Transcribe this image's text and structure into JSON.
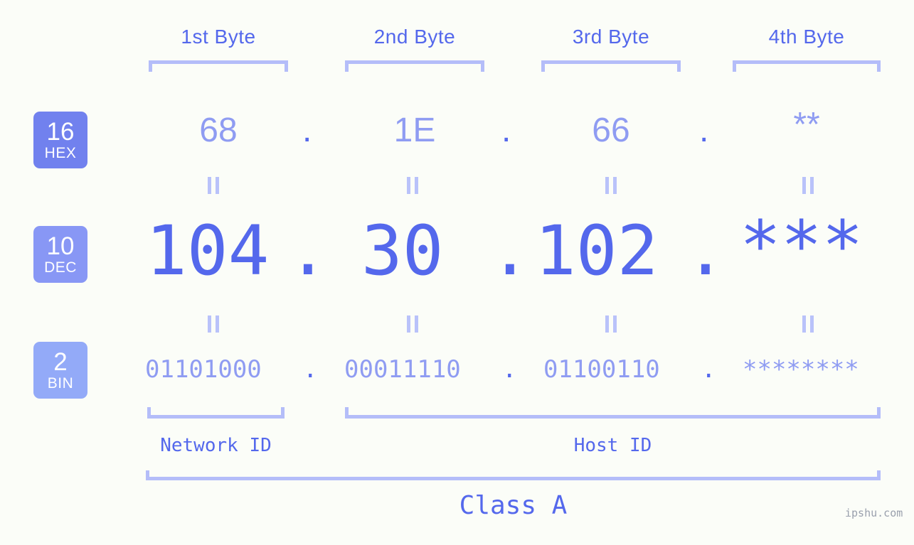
{
  "page": {
    "background": "#fbfdf8",
    "accent": "#5468ec",
    "accent_light": "#8f9cf2",
    "bracket_color": "#b4bdf9",
    "watermark": "ipshu.com"
  },
  "byte_headers": [
    {
      "label": "1st Byte"
    },
    {
      "label": "2nd Byte"
    },
    {
      "label": "3rd Byte"
    },
    {
      "label": "4th Byte"
    }
  ],
  "bases": [
    {
      "number": "16",
      "name": "HEX",
      "color": "#7181ee"
    },
    {
      "number": "10",
      "name": "DEC",
      "color": "#8897f5"
    },
    {
      "number": "2",
      "name": "BIN",
      "color": "#93aaf8"
    }
  ],
  "rows": {
    "hex": {
      "values": [
        "68",
        "1E",
        "66",
        "**"
      ],
      "separator": "."
    },
    "dec": {
      "values": [
        "104",
        "30",
        "102",
        "***"
      ],
      "separator": "."
    },
    "bin": {
      "values": [
        "01101000",
        "00011110",
        "01100110",
        "********"
      ],
      "separator": "."
    }
  },
  "equals_symbol": "||",
  "segments": {
    "network_id": "Network ID",
    "host_id": "Host ID",
    "class": "Class A"
  }
}
